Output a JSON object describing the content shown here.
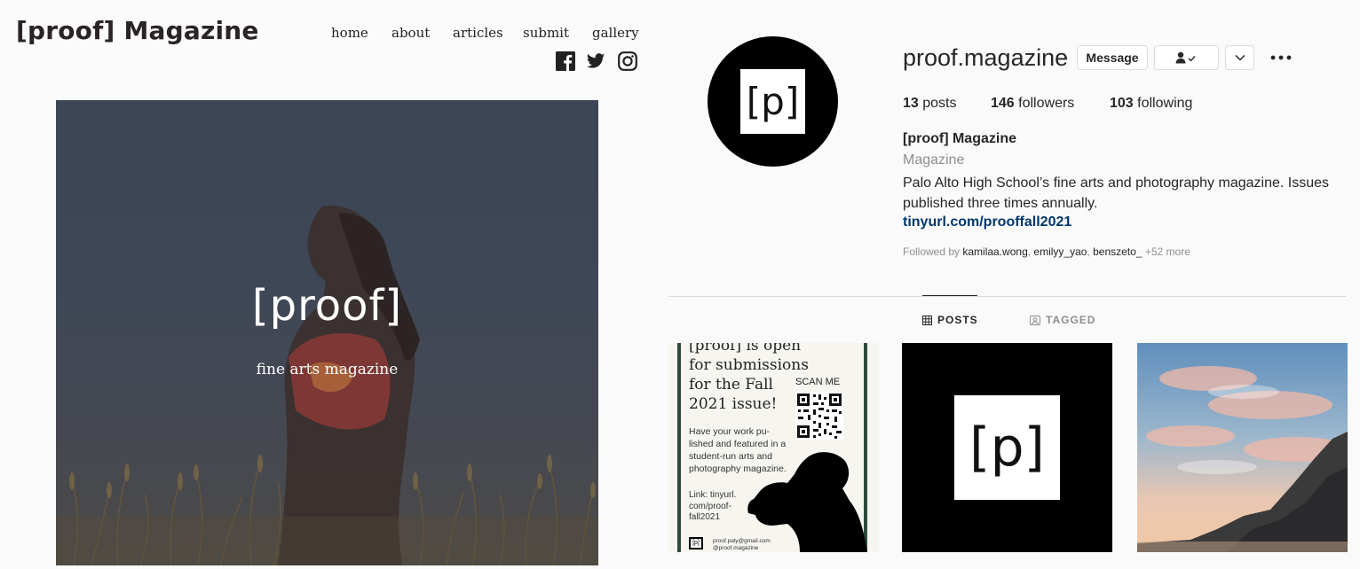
{
  "site": {
    "title": "[proof] Magazine",
    "nav": [
      "home",
      "about",
      "articles",
      "submit",
      "gallery"
    ],
    "social_icons": [
      "facebook-icon",
      "twitter-icon",
      "instagram-icon"
    ],
    "hero": {
      "title": "[proof]",
      "subtitle": "fine arts magazine"
    }
  },
  "instagram": {
    "avatar_text": "[p]",
    "username": "proof.magazine",
    "buttons": {
      "message": "Message"
    },
    "stats": {
      "posts_count": "13",
      "posts_label": "posts",
      "followers_count": "146",
      "followers_label": "followers",
      "following_count": "103",
      "following_label": "following"
    },
    "bio": {
      "name": "[proof] Magazine",
      "category": "Magazine",
      "text": "Palo Alto High School’s fine arts and photography magazine. Issues published three times annually.",
      "link": "tinyurl.com/prooffall2021"
    },
    "followed_by": {
      "prefix": "Followed by",
      "users": [
        "kamilaa.wong",
        "emilyy_yao",
        "benszeto_"
      ],
      "more": "+52 more"
    },
    "tabs": {
      "posts": "POSTS",
      "tagged": "TAGGED"
    },
    "posts": {
      "flyer": {
        "headline": "[proof] is open for submissions for the Fall 2021 issue!",
        "scan": "SCAN ME",
        "body": "Have your work pu-lished and featured in a student-run arts and photography magazine.",
        "link": "Link: tinyurl. com/proof-fall2021",
        "footer_logo": "[p]",
        "footer_email": "proof.paly@gmail.com",
        "footer_handle": "@proof.magazine"
      },
      "logo_text": "[p]"
    }
  }
}
